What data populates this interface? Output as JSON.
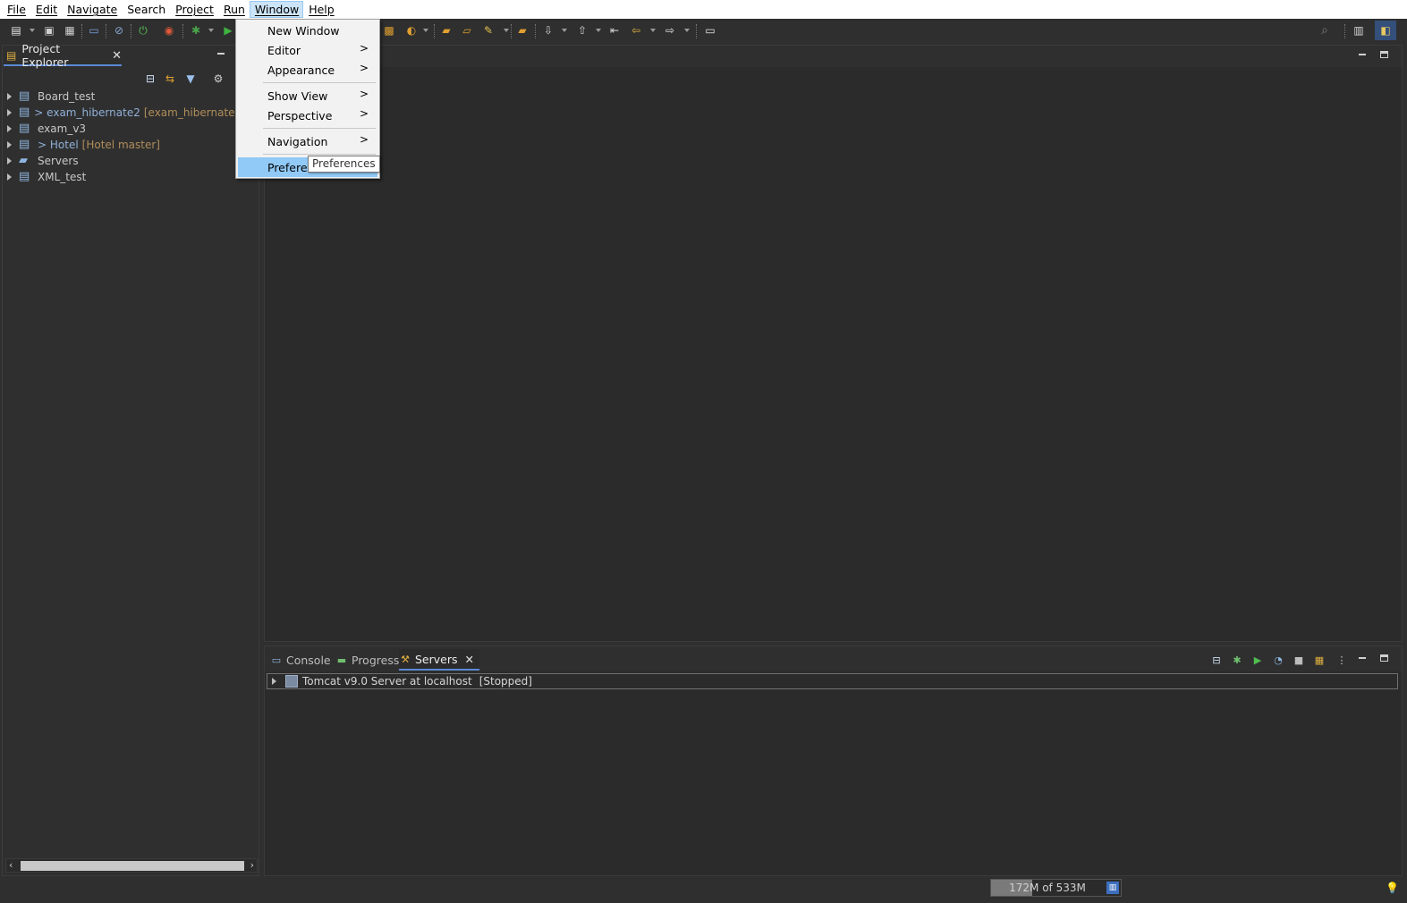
{
  "menubar": {
    "items": [
      "File",
      "Edit",
      "Navigate",
      "Search",
      "Project",
      "Run",
      "Window",
      "Help"
    ],
    "active": "Window"
  },
  "window_menu": {
    "items": [
      {
        "label": "New Window",
        "submenu": false
      },
      {
        "label": "Editor",
        "submenu": true
      },
      {
        "label": "Appearance",
        "submenu": true
      },
      {
        "label": "Show View",
        "submenu": true
      },
      {
        "label": "Perspective",
        "submenu": true
      },
      {
        "label": "Navigation",
        "submenu": true
      },
      {
        "label": "Preferences",
        "submenu": false
      }
    ],
    "submenu_arrow": ">",
    "hovered": "Preferences",
    "tooltip": "Preferences"
  },
  "explorer": {
    "title": "Project Explorer",
    "projects": [
      {
        "name": "Board_test",
        "git_prefix": "",
        "branch": ""
      },
      {
        "name": "exam_hibernate2",
        "git_prefix": "> ",
        "branch": "[exam_hibernate2 master]"
      },
      {
        "name": "exam_v3",
        "git_prefix": "",
        "branch": ""
      },
      {
        "name": "Hotel",
        "git_prefix": "> ",
        "branch": "[Hotel master]"
      },
      {
        "name": "Servers",
        "git_prefix": "",
        "branch": ""
      },
      {
        "name": "XML_test",
        "git_prefix": "",
        "branch": ""
      }
    ]
  },
  "bottom_panel": {
    "tabs": [
      {
        "label": "Console",
        "active": false
      },
      {
        "label": "Progress",
        "active": false
      },
      {
        "label": "Servers",
        "active": true
      }
    ],
    "servers": [
      {
        "name": "Tomcat v9.0 Server at localhost",
        "status": "[Stopped]"
      }
    ]
  },
  "status": {
    "heap": "172M of 533M",
    "heap_used_fraction": 0.32
  },
  "colors": {
    "accent": "#5a8ad6",
    "menu_hover": "#91c9f7",
    "git_label": "#8fb0d8",
    "branch_label": "#b08d5a"
  }
}
